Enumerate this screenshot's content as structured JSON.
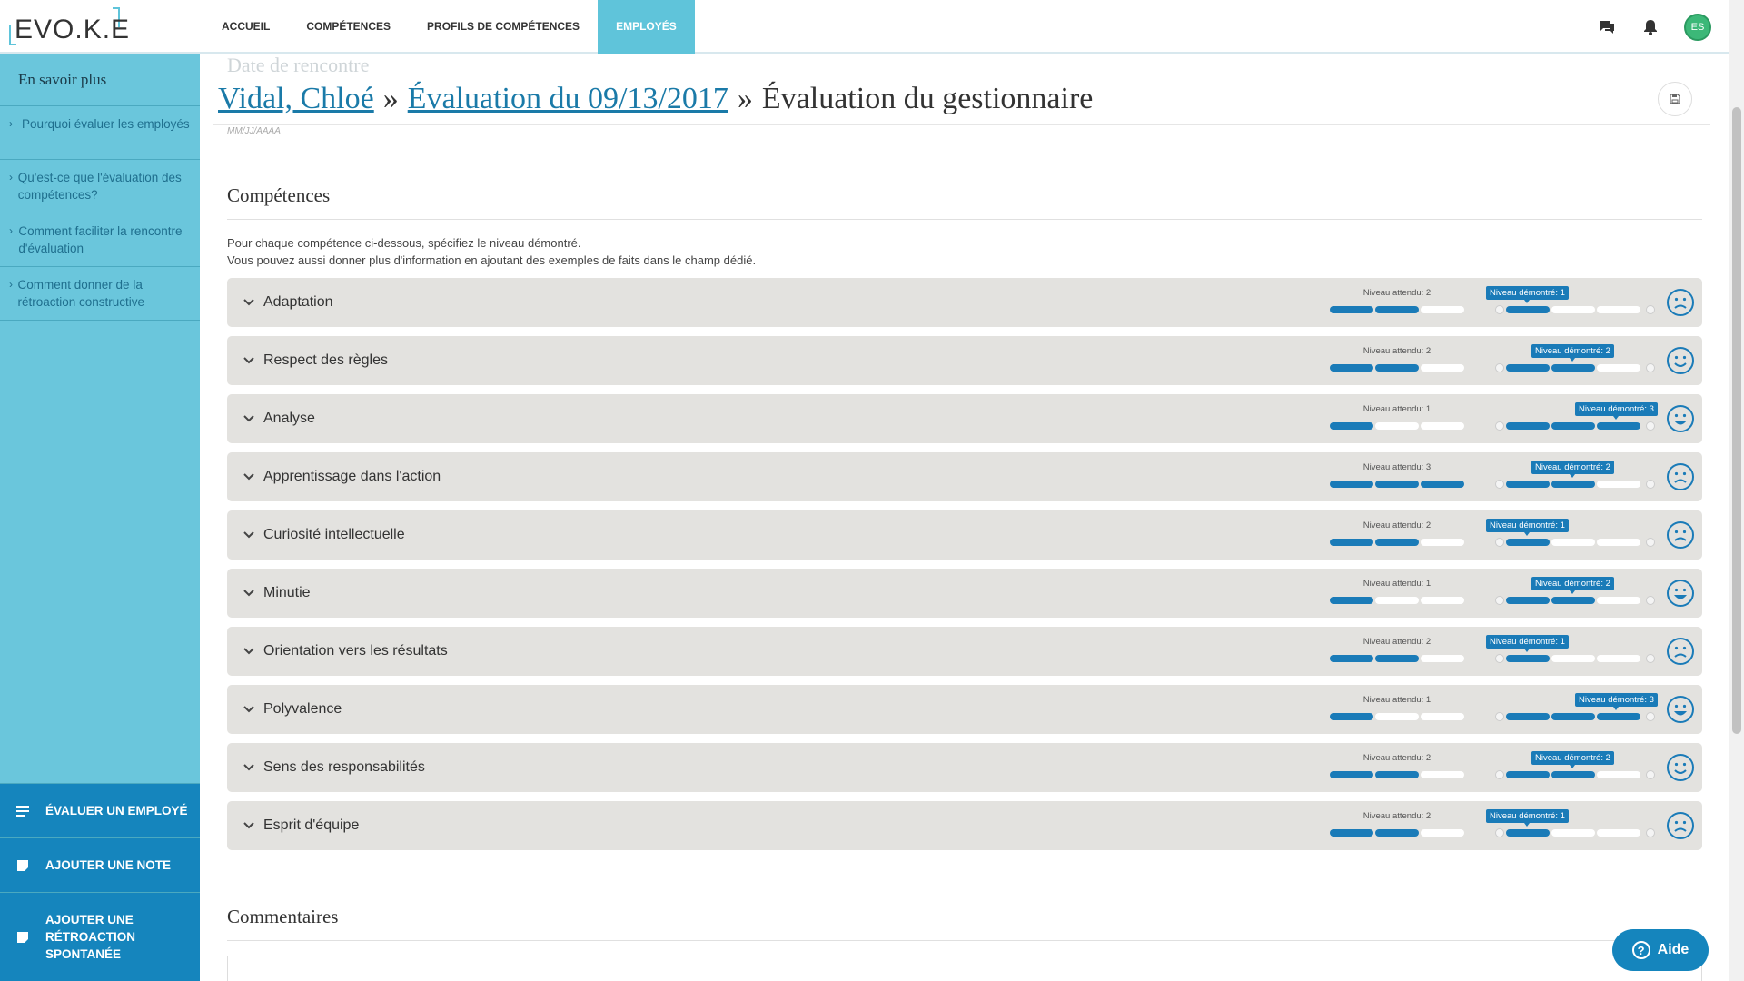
{
  "brand": {
    "logo_text": "EVO.K.E"
  },
  "nav": {
    "items": [
      {
        "label": "ACCUEIL",
        "active": false
      },
      {
        "label": "COMPÉTENCES",
        "active": false
      },
      {
        "label": "PROFILS DE COMPÉTENCES",
        "active": false
      },
      {
        "label": "EMPLOYÉS",
        "active": true
      }
    ],
    "avatar_initials": "ES",
    "icons": [
      "chat-icon",
      "bell-icon"
    ]
  },
  "sidebar": {
    "title": "En savoir plus",
    "links": [
      {
        "label": "Pourquoi évaluer les employés"
      },
      {
        "label": "Qu'est-ce que l'évaluation des compétences?"
      },
      {
        "label": "Comment faciliter la rencontre d'évaluation"
      },
      {
        "label": "Comment donner de la rétroaction constructive"
      }
    ],
    "actions": [
      {
        "label": "ÉVALUER UN EMPLOYÉ",
        "icon": "list-icon"
      },
      {
        "label": "AJOUTER UNE NOTE",
        "icon": "note-icon"
      },
      {
        "label": "AJOUTER UNE RÉTROACTION SPONTANÉE",
        "icon": "note-icon"
      }
    ]
  },
  "main": {
    "faded_label": "Date de rencontre",
    "date_hint": "MM/JJ/AAAA",
    "breadcrumb": {
      "employee": "Vidal, Chloé",
      "evaluation": "Évaluation du 09/13/2017",
      "current": "Évaluation du gestionnaire",
      "separator": "»"
    },
    "competences_title": "Compétences",
    "intro_line1": "Pour chaque compétence ci-dessous, spécifiez le niveau démontré.",
    "intro_line2": "Vous pouvez aussi donner plus d'information en ajoutant des exemples de faits dans le champ dédié.",
    "expected_prefix": "Niveau attendu: ",
    "demonstrated_prefix": "Niveau démontré: ",
    "competences": [
      {
        "name": "Adaptation",
        "expected": 2,
        "demonstrated": 1,
        "mood": "sad"
      },
      {
        "name": "Respect des règles",
        "expected": 2,
        "demonstrated": 2,
        "mood": "smile"
      },
      {
        "name": "Analyse",
        "expected": 1,
        "demonstrated": 3,
        "mood": "happy"
      },
      {
        "name": "Apprentissage dans l'action",
        "expected": 3,
        "demonstrated": 2,
        "mood": "sad"
      },
      {
        "name": "Curiosité intellectuelle",
        "expected": 2,
        "demonstrated": 1,
        "mood": "sad"
      },
      {
        "name": "Minutie",
        "expected": 1,
        "demonstrated": 2,
        "mood": "happy"
      },
      {
        "name": "Orientation vers les résultats",
        "expected": 2,
        "demonstrated": 1,
        "mood": "sad"
      },
      {
        "name": "Polyvalence",
        "expected": 1,
        "demonstrated": 3,
        "mood": "happy"
      },
      {
        "name": "Sens des responsabilités",
        "expected": 2,
        "demonstrated": 2,
        "mood": "smile"
      },
      {
        "name": "Esprit d'équipe",
        "expected": 2,
        "demonstrated": 1,
        "mood": "sad"
      }
    ],
    "comments_title": "Commentaires"
  },
  "help": {
    "label": "Aide"
  },
  "colors": {
    "accent": "#1585bd",
    "sidebar": "#6ac6dc",
    "bar_on": "#1a7bb8",
    "row_bg": "#e3e2df"
  }
}
